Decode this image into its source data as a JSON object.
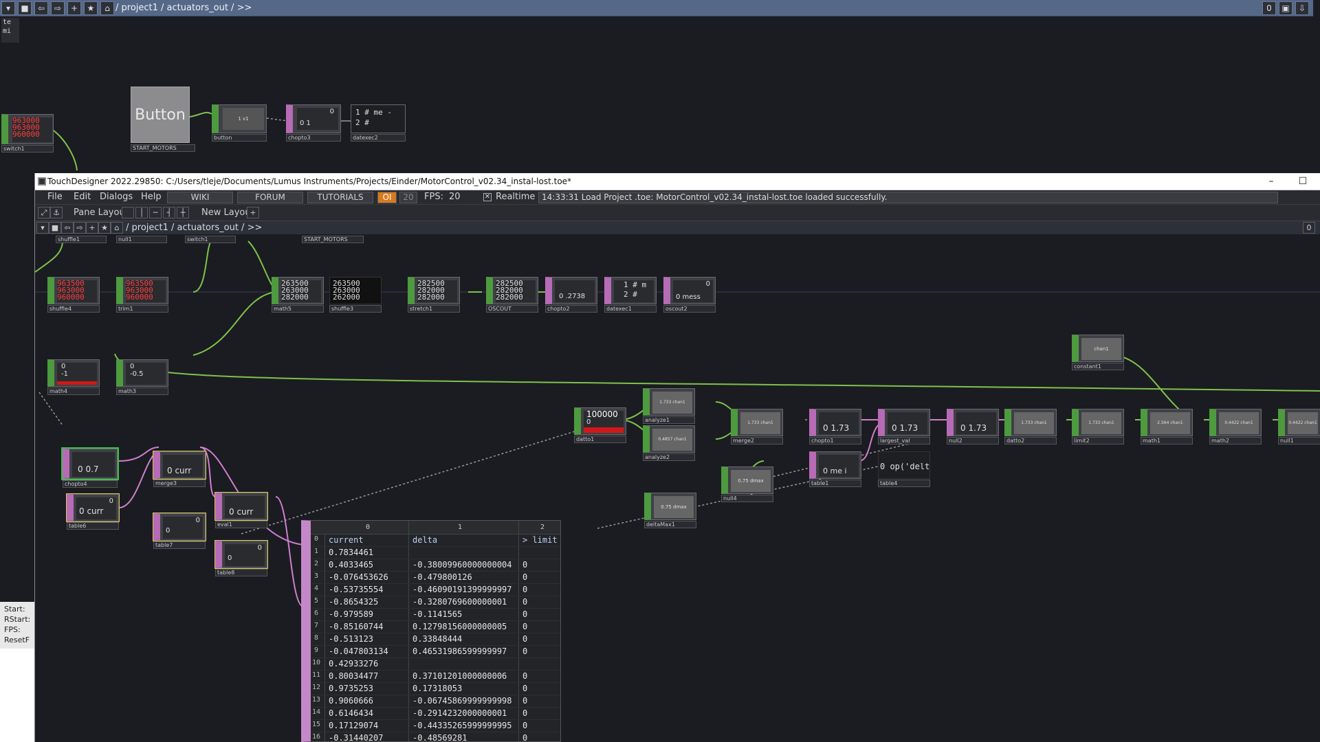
{
  "bg_path": {
    "path": "/ project1 / actuators_out / >>",
    "right_count": "0"
  },
  "bg_nodes": {
    "button_label": "Button",
    "start_motors": "START_MOTORS",
    "switch1": "switch1",
    "switch1_vals": [
      "963000",
      "963000",
      "960000"
    ],
    "button": "button",
    "button_val": "1 v1",
    "chopto3": "chopto3",
    "chopto3_val": "0",
    "chopto3_val2": "0 1",
    "datexec2": "datexec2",
    "datexec2_lines": [
      "1 # me -",
      "2 #"
    ],
    "corner_text": [
      "te",
      "mi"
    ]
  },
  "window": {
    "title": "TouchDesigner 2022.29850: C:/Users/tleje/Documents/Lumus Instruments/Projects/Einder/MotorControl_v02.34_instal-lost.toe*",
    "minimize": "–",
    "maximize": "☐"
  },
  "menu": {
    "file": "File",
    "edit": "Edit",
    "dialogs": "Dialogs",
    "help": "Help",
    "wiki": "WIKI",
    "forum": "FORUM",
    "tutorials": "TUTORIALS",
    "oi": "OI",
    "oi_num": "20",
    "fps_label": "FPS:",
    "fps_value": "20",
    "realtime": "Realtime",
    "status": "14:33:31 Load Project .toe: MotorControl_v02.34_instal-lost.toe loaded successfully."
  },
  "panebar": {
    "pane_layout": "Pane Layout",
    "new_layout": "New Layout",
    "plus": "+"
  },
  "path2": {
    "path": "/ project1 / actuators_out / >>",
    "right_count": "0"
  },
  "nodes": {
    "shuffle1": "shuffle1",
    "null1": "null1",
    "switch1": "switch1",
    "start_motors": "START_MOTORS",
    "button": "button",
    "chopto3": "chopto3",
    "datexec2": "datexec2",
    "shuffle4": "shuffle4",
    "shuffle4_vals": [
      "963500",
      "963000",
      "960000"
    ],
    "trim1": "trim1",
    "trim1_vals": [
      "963500",
      "963000",
      "960000"
    ],
    "math5": "math5",
    "math5_vals": [
      "263500",
      "263000",
      "282000"
    ],
    "shuffle3": "shuffle3",
    "shuffle3_vals": [
      "263500",
      "263000",
      "262000"
    ],
    "stretch1": "stretch1",
    "stretch1_vals": [
      "282500",
      "282000",
      "282000"
    ],
    "oscout": "OSCOUT",
    "oscout_vals": [
      "282500",
      "282000",
      "282000"
    ],
    "chopto2": "chopto2",
    "chopto2_val": "0 .2738",
    "datexec1": "datexec1",
    "datexec1_lines": [
      "1 # m",
      "2 #"
    ],
    "oscout2": "oscout2",
    "oscout2_val": "0",
    "oscout2_val2": "0 mess",
    "math4": "math4",
    "math4_vals": [
      "0",
      "-1"
    ],
    "math3": "math3",
    "math3_vals": [
      "0",
      "-0.5"
    ],
    "constant1": "constant1",
    "constant1_val": "chan1",
    "datto1": "datto1",
    "datto1_val": "100000",
    "datto1_val2": "0",
    "analyze1": "analyze1",
    "analyze1_val": "1.733 chan1",
    "analyze2": "analyze2",
    "analyze2_val": "0.4857 chan1",
    "merge2": "merge2",
    "merge2_val": "1.733 chan1",
    "chopto1": "chopto1",
    "chopto1_val": "0 1.73",
    "largest_val": "largest_val",
    "largest_val_val": "0 1.73",
    "null2": "null2",
    "null2_val": "0 1.73",
    "datto2": "datto2",
    "datto2_val": "1.733 chan1",
    "limit2": "limit2",
    "limit2_val": "1.733 chan1",
    "math1": "math1",
    "math1_val": "2.564 chan1",
    "math2": "math2",
    "math2_val": "0.4422 chan1",
    "null1b": "null1",
    "null1b_val": "0.4422 chan1",
    "chopto4": "chopto4",
    "chopto4_val": "0 0.7",
    "merge3": "merge3",
    "merge3_val": "0 curr",
    "table6": "table6",
    "table6_val": "0",
    "table6_val2": "0 curr",
    "table7": "table7",
    "table7_val": "0",
    "table7_val2": "0",
    "eval1": "eval1",
    "eval1_val": "0 curr",
    "table8": "table8",
    "table8_val": "0",
    "table8_val2": "0",
    "null4": "null4",
    "null4_val": "0.75 dmax",
    "table1": "table1",
    "table1_val": "0 me i",
    "table4": "table4",
    "table4_val": "0 op('delt",
    "deltaMax1": "deltaMax1",
    "deltaMax1_val": "0.75 dmax"
  },
  "leftpanel": {
    "lines": [
      "Start:",
      "RStart:",
      "FPS:",
      "ResetF"
    ]
  },
  "table": {
    "col_headers": [
      "0",
      "1",
      "2"
    ],
    "rows": [
      {
        "n": "0",
        "c0": "current",
        "c1": "delta",
        "c2": "> limit"
      },
      {
        "n": "1",
        "c0": "0.7834461",
        "c1": "",
        "c2": ""
      },
      {
        "n": "2",
        "c0": "0.4033465",
        "c1": "-0.38009960000000004",
        "c2": "0"
      },
      {
        "n": "3",
        "c0": "-0.076453626",
        "c1": "-0.479800126",
        "c2": "0"
      },
      {
        "n": "4",
        "c0": "-0.53735554",
        "c1": "-0.46090191399999997",
        "c2": "0"
      },
      {
        "n": "5",
        "c0": "-0.8654325",
        "c1": "-0.3280769600000001",
        "c2": "0"
      },
      {
        "n": "6",
        "c0": "-0.979589",
        "c1": "-0.1141565",
        "c2": "0"
      },
      {
        "n": "7",
        "c0": "-0.85160744",
        "c1": "0.12798156000000005",
        "c2": "0"
      },
      {
        "n": "8",
        "c0": "-0.513123",
        "c1": "0.33848444",
        "c2": "0"
      },
      {
        "n": "9",
        "c0": "-0.047803134",
        "c1": "0.46531986599999997",
        "c2": "0"
      },
      {
        "n": "10",
        "c0": "0.42933276",
        "c1": "",
        "c2": ""
      },
      {
        "n": "11",
        "c0": "0.80034477",
        "c1": "0.37101201000000006",
        "c2": "0"
      },
      {
        "n": "12",
        "c0": "0.9735253",
        "c1": "0.17318053",
        "c2": "0"
      },
      {
        "n": "13",
        "c0": "0.9060666",
        "c1": "-0.06745869999999998",
        "c2": "0"
      },
      {
        "n": "14",
        "c0": "0.6146434",
        "c1": "-0.2914232000000001",
        "c2": "0"
      },
      {
        "n": "15",
        "c0": "0.17129074",
        "c1": "-0.44335265999999995",
        "c2": "0"
      },
      {
        "n": "16",
        "c0": "-0.31440207",
        "c1": "-0.48569281",
        "c2": "0"
      }
    ]
  },
  "colors": {
    "top_op": "#4d9b3e",
    "chop": "#b76bb6",
    "wire_green": "#7fc24c",
    "wire_pink": "#d07fcf",
    "path_bar": "#556888"
  }
}
